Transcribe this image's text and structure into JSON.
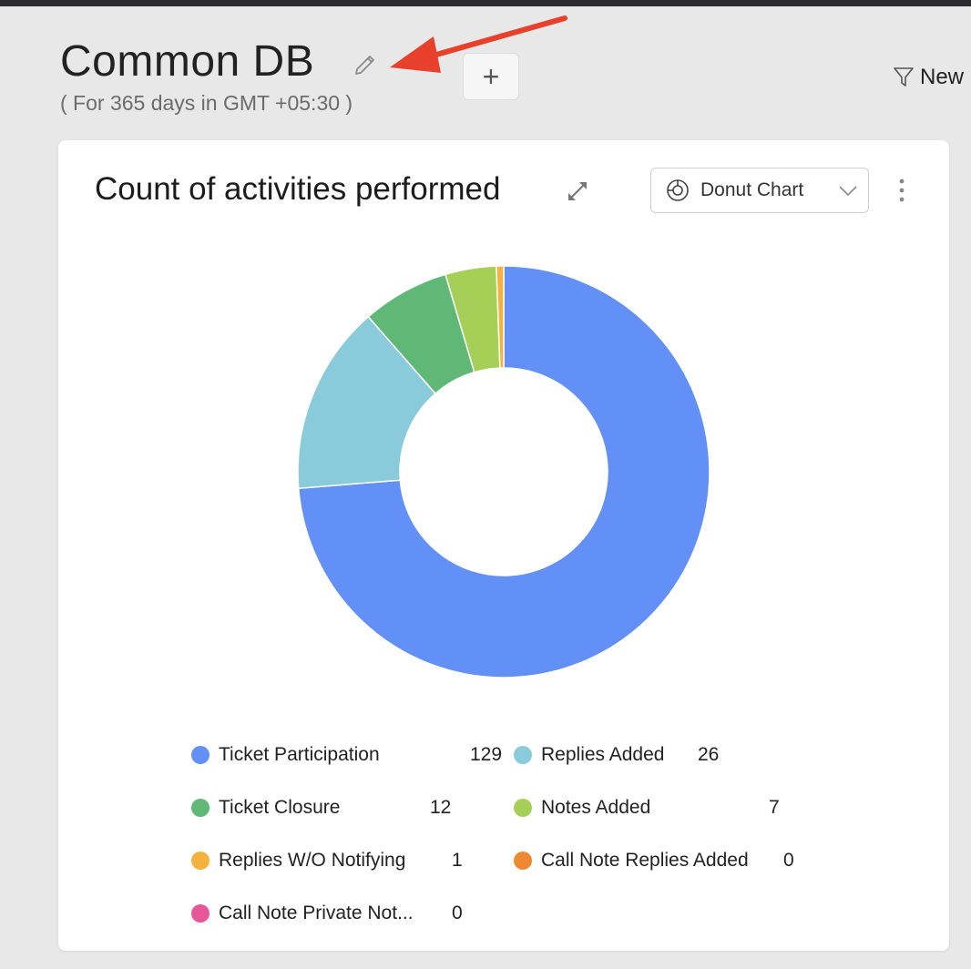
{
  "header": {
    "title": "Common DB",
    "subtitle": "( For 365 days in GMT +05:30 )",
    "add_label": "+",
    "filter_label": "New"
  },
  "card": {
    "title": "Count of activities performed",
    "chart_type_label": "Donut Chart"
  },
  "colors": {
    "annotation_arrow": "#e8402a"
  },
  "chart_data": {
    "type": "pie",
    "variant": "donut",
    "categories": [
      "Ticket Participation",
      "Replies Added",
      "Ticket Closure",
      "Notes Added",
      "Replies W/O Notifying",
      "Call Note Replies Added",
      "Call Note Private Not..."
    ],
    "values": [
      129,
      26,
      12,
      7,
      1,
      0,
      0
    ],
    "colors": [
      "#6290f6",
      "#89cadb",
      "#60b876",
      "#a6cf58",
      "#f5b13d",
      "#ee8833",
      "#e8579a"
    ],
    "legend_position": "bottom"
  }
}
